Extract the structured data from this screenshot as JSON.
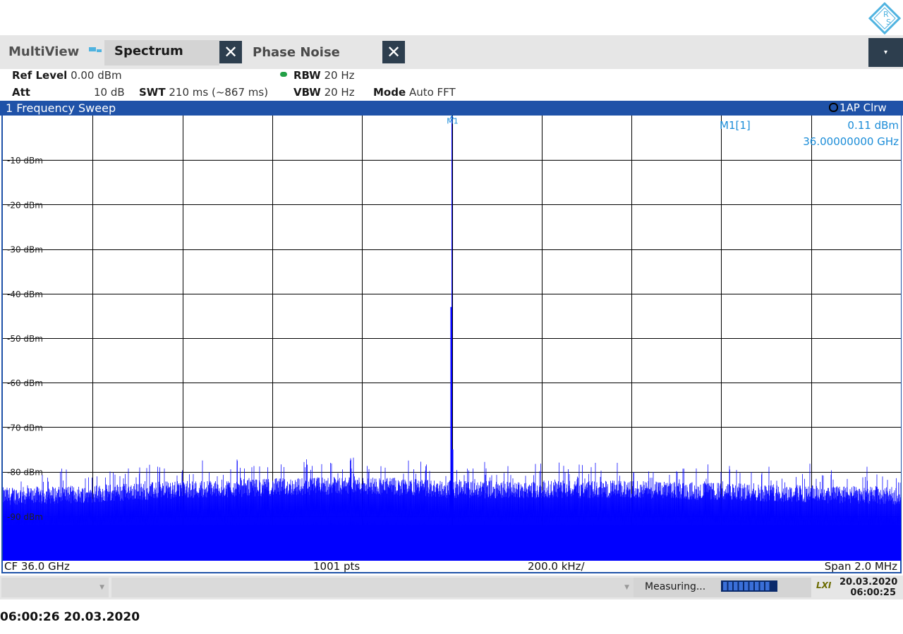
{
  "app": {
    "brand_letters": [
      "R",
      "S"
    ],
    "tabs": [
      {
        "label": "MultiView"
      },
      {
        "label": "Spectrum",
        "active": true
      },
      {
        "label": "Phase Noise"
      }
    ],
    "close_symbol": "✕",
    "menu_symbol": "▾"
  },
  "settings": {
    "ref_level": {
      "name": "Ref Level",
      "value": "0.00 dBm"
    },
    "att": {
      "name": "Att",
      "value": "10 dB"
    },
    "swt": {
      "name": "SWT",
      "value": "210 ms (~867 ms)"
    },
    "rbw": {
      "name": "RBW",
      "value": "20 Hz"
    },
    "vbw": {
      "name": "VBW",
      "value": "20 Hz"
    },
    "mode": {
      "name": "Mode",
      "value": "Auto FFT"
    }
  },
  "window": {
    "title": "1 Frequency Sweep",
    "trace_label": "1AP Clrw",
    "marker": {
      "flag": "M1",
      "name": "M1[1]",
      "level": "0.11 dBm",
      "frequency": "36.00000000 GHz"
    },
    "footer": {
      "cf": "CF 36.0 GHz",
      "points": "1001 pts",
      "div": "200.0 kHz/",
      "span": "Span 2.0 MHz"
    }
  },
  "status": {
    "measuring": "Measuring...",
    "lxi": "LXI",
    "date": "20.03.2020",
    "time": "06:00:25",
    "progress_blocks": 9
  },
  "timestamp": "06:00:26  20.03.2020",
  "colors": {
    "trace": "#0000ff",
    "marker_text": "#1a8cd8",
    "window_bar": "#1f52a8",
    "dark_button": "#2d3e4e"
  },
  "chart_data": {
    "type": "line",
    "title": "1 Frequency Sweep",
    "xlabel": "",
    "ylabel": "",
    "x_unit": "MHz",
    "xlim": [
      35999,
      36001
    ],
    "ylim": [
      -100,
      0
    ],
    "y_tick_labels": [
      "-10 dBm",
      "-20 dBm",
      "-30 dBm",
      "-40 dBm",
      "-50 dBm",
      "-60 dBm",
      "-70 dBm",
      "-80 dBm",
      "-90 dBm"
    ],
    "y_ticks": [
      -10,
      -20,
      -30,
      -40,
      -50,
      -60,
      -70,
      -80,
      -90
    ],
    "x_divisions": 10,
    "grid": true,
    "series": [
      {
        "color": "#0000ff",
        "noise_floor_dbm": -90,
        "noise_profile": [
          [
            35999.0,
            -90.5
          ],
          [
            35999.2,
            -90
          ],
          [
            35999.4,
            -89
          ],
          [
            35999.6,
            -88.5
          ],
          [
            35999.8,
            -88
          ],
          [
            36000.0,
            -89
          ],
          [
            36000.2,
            -89
          ],
          [
            36000.4,
            -89
          ],
          [
            36000.6,
            -89.5
          ],
          [
            36000.8,
            -90
          ],
          [
            36001.0,
            -90.5
          ]
        ],
        "peak": {
          "x": 36000.0,
          "y": 0.11
        },
        "peak_skirt": [
          [
            35999.998,
            -43
          ],
          [
            36000.002,
            -75
          ],
          [
            35999.996,
            -82
          ]
        ]
      }
    ]
  }
}
